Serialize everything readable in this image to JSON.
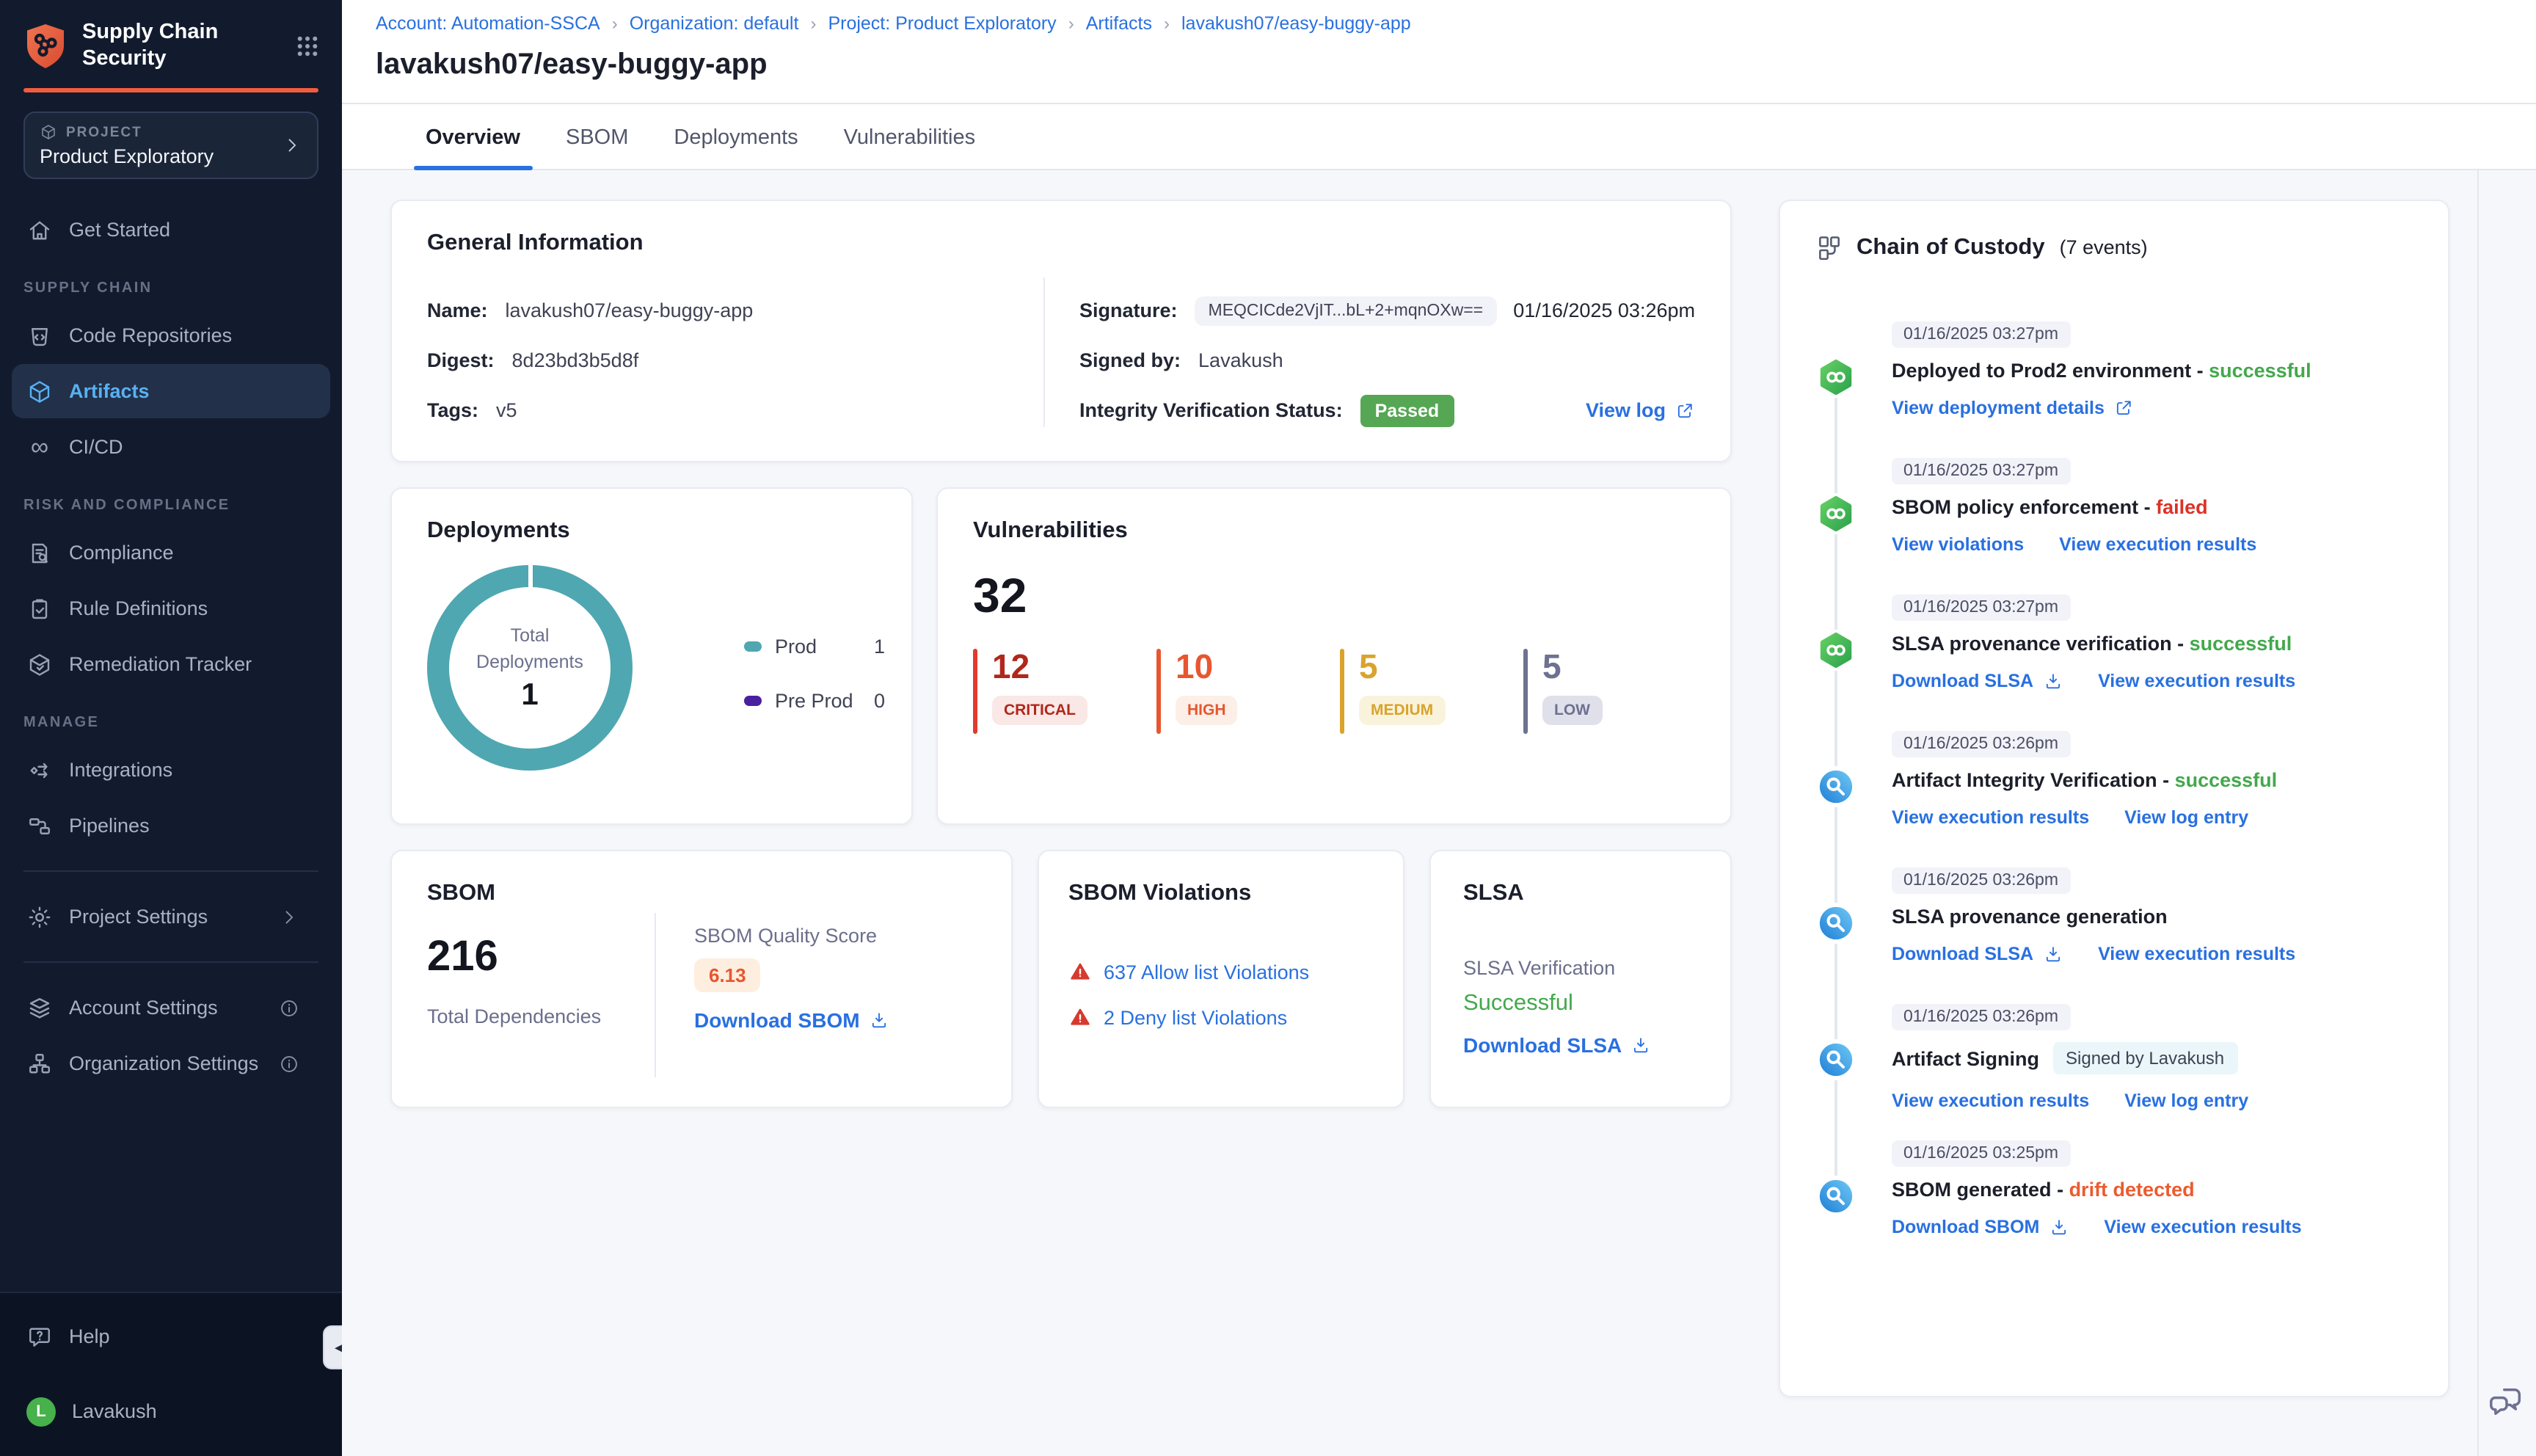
{
  "app": {
    "title_line1": "Supply Chain",
    "title_line2": "Security"
  },
  "colors": {
    "accent_red": "#F25C3F",
    "link_blue": "#2970E0",
    "success_green": "#43A84C",
    "fail_red": "#DC3227",
    "drift_orange": "#EC5B2F",
    "teal": "#4FA7B1",
    "preprod_purple": "#4A1FA0",
    "passed_badge_green": "#56A754",
    "sidebar_bg": "#121B2E"
  },
  "sidebar": {
    "project_label": "PROJECT",
    "project_name": "Product Exploratory",
    "sections": [
      {
        "label": "",
        "items": [
          {
            "icon": "home",
            "label": "Get Started"
          }
        ]
      },
      {
        "label": "SUPPLY CHAIN",
        "items": [
          {
            "icon": "repo",
            "label": "Code Repositories"
          },
          {
            "icon": "cube",
            "label": "Artifacts",
            "active": true
          },
          {
            "icon": "infinity",
            "label": "CI/CD"
          }
        ]
      },
      {
        "label": "RISK AND COMPLIANCE",
        "items": [
          {
            "icon": "doc-search",
            "label": "Compliance"
          },
          {
            "icon": "clipboard",
            "label": "Rule Definitions"
          },
          {
            "icon": "box-check",
            "label": "Remediation Tracker"
          }
        ]
      },
      {
        "label": "MANAGE",
        "items": [
          {
            "icon": "integrations",
            "label": "Integrations"
          },
          {
            "icon": "pipelines",
            "label": "Pipelines"
          }
        ]
      }
    ],
    "project_settings": "Project Settings",
    "account_settings": "Account Settings",
    "org_settings": "Organization Settings",
    "help_label": "Help",
    "user": {
      "initial": "L",
      "name": "Lavakush"
    }
  },
  "breadcrumb": [
    "Account: Automation-SSCA",
    "Organization: default",
    "Project: Product Exploratory",
    "Artifacts",
    "lavakush07/easy-buggy-app"
  ],
  "page_title": "lavakush07/easy-buggy-app",
  "tabs": [
    {
      "label": "Overview",
      "active": true
    },
    {
      "label": "SBOM",
      "active": false
    },
    {
      "label": "Deployments",
      "active": false
    },
    {
      "label": "Vulnerabilities",
      "active": false
    }
  ],
  "general_info": {
    "title": "General Information",
    "name_label": "Name:",
    "name": "lavakush07/easy-buggy-app",
    "digest_label": "Digest:",
    "digest": "8d23bd3b5d8f",
    "tags_label": "Tags:",
    "tags": "v5",
    "signature_label": "Signature:",
    "signature": "MEQCICde2VjIT...bL+2+mqnOXw==",
    "signature_time": "01/16/2025 03:26pm",
    "signed_by_label": "Signed by:",
    "signed_by": "Lavakush",
    "integrity_label": "Integrity Verification Status:",
    "integrity_status": "Passed",
    "view_log": "View log"
  },
  "deployments": {
    "title": "Deployments",
    "center_label_1": "Total",
    "center_label_2": "Deployments",
    "total": "1",
    "legend": [
      {
        "label": "Prod",
        "value": "1",
        "color": "#4FA7B1"
      },
      {
        "label": "Pre Prod",
        "value": "0",
        "color": "#4A1FA0"
      }
    ]
  },
  "vulnerabilities": {
    "title": "Vulnerabilities",
    "total": "32",
    "severities": [
      {
        "count": "12",
        "label": "CRITICAL",
        "color": "#B1271B",
        "bar": "#E23B2B",
        "chip_bg": "#F9E8E6"
      },
      {
        "count": "10",
        "label": "HIGH",
        "color": "#E8562F",
        "bar": "#E8562F",
        "chip_bg": "#FBEFE7"
      },
      {
        "count": "5",
        "label": "MEDIUM",
        "color": "#D9A32C",
        "bar": "#D9A32C",
        "chip_bg": "#FAF3DC"
      },
      {
        "count": "5",
        "label": "LOW",
        "color": "#6E7191",
        "bar": "#6E7191",
        "chip_bg": "#DFE0EA"
      }
    ]
  },
  "sbom": {
    "title": "SBOM",
    "total": "216",
    "total_label": "Total Dependencies",
    "score_label": "SBOM Quality Score",
    "score": "6.13",
    "download": "Download SBOM"
  },
  "sbom_violations": {
    "title": "SBOM Violations",
    "items": [
      {
        "label": "637 Allow list Violations"
      },
      {
        "label": "2 Deny list Violations"
      }
    ]
  },
  "slsa": {
    "title": "SLSA",
    "verification_label": "SLSA Verification",
    "status": "Successful",
    "download": "Download SLSA"
  },
  "chain": {
    "title": "Chain of Custody",
    "events_count": "(7 events)",
    "events": [
      {
        "time": "01/16/2025 03:27pm",
        "icon": "cd",
        "title": "Deployed to Prod2 environment",
        "status": "successful",
        "status_color": "#43A84C",
        "links": [
          {
            "label": "View deployment details",
            "icon": "external"
          }
        ]
      },
      {
        "time": "01/16/2025 03:27pm",
        "icon": "cd",
        "title": "SBOM policy enforcement",
        "status": "failed",
        "status_color": "#DC3227",
        "links": [
          {
            "label": "View violations"
          },
          {
            "label": "View execution results"
          }
        ]
      },
      {
        "time": "01/16/2025 03:27pm",
        "icon": "cd",
        "title": "SLSA provenance verification",
        "status": "successful",
        "status_color": "#43A84C",
        "links": [
          {
            "label": "Download SLSA",
            "icon": "download"
          },
          {
            "label": "View execution results"
          }
        ]
      },
      {
        "time": "01/16/2025 03:26pm",
        "icon": "scs",
        "title": "Artifact Integrity Verification",
        "status": "successful",
        "status_color": "#43A84C",
        "links": [
          {
            "label": "View execution results"
          },
          {
            "label": "View log entry"
          }
        ]
      },
      {
        "time": "01/16/2025 03:26pm",
        "icon": "scs",
        "title": "SLSA provenance generation",
        "links": [
          {
            "label": "Download SLSA",
            "icon": "download"
          },
          {
            "label": "View execution results"
          }
        ]
      },
      {
        "time": "01/16/2025 03:26pm",
        "icon": "scs",
        "title": "Artifact Signing",
        "chip": "Signed by Lavakush",
        "links": [
          {
            "label": "View execution results"
          },
          {
            "label": "View log entry"
          }
        ]
      },
      {
        "time": "01/16/2025 03:25pm",
        "icon": "scs",
        "title": "SBOM generated",
        "status": "drift detected",
        "status_color": "#EC5B2F",
        "links": [
          {
            "label": "Download SBOM",
            "icon": "download"
          },
          {
            "label": "View execution results"
          }
        ]
      }
    ]
  }
}
